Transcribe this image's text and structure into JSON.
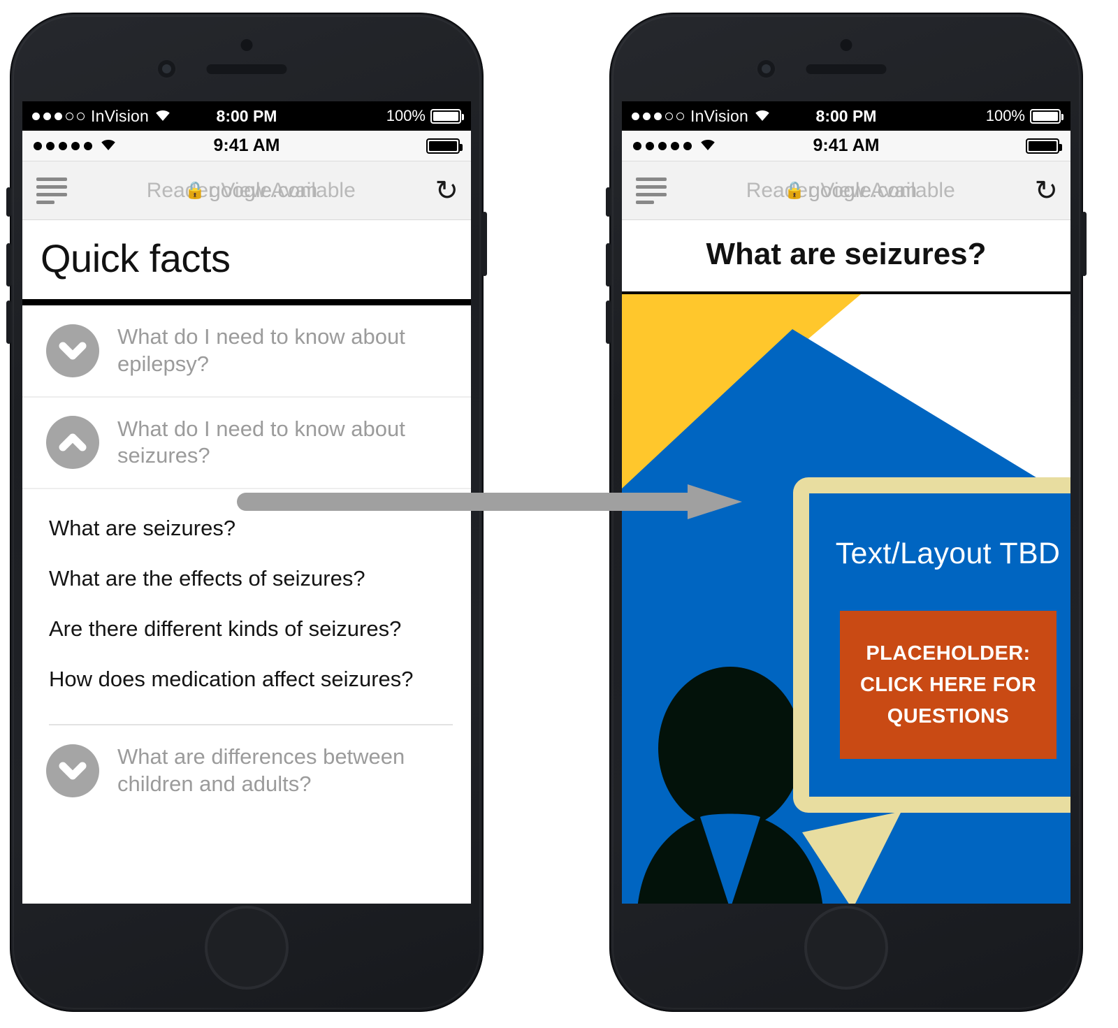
{
  "status_bar": {
    "invision": {
      "carrier": "InVision",
      "time": "8:00 PM",
      "battery_percent": "100%",
      "signal_filled": 3,
      "signal_total": 5,
      "wifi_icon": "wifi-icon",
      "battery_icon": "battery-full-icon"
    },
    "ios": {
      "time": "9:41 AM",
      "signal_dots": 5,
      "wifi_icon": "wifi-icon",
      "battery_icon": "battery-full-icon"
    }
  },
  "browser": {
    "reader_icon": "reader-view-icon",
    "reader_label": "Reader View Available",
    "lock_icon": "lock-icon",
    "site_label": "google.com",
    "reload_icon": "reload-icon",
    "reload_glyph": "↻"
  },
  "left_phone": {
    "page_title": "Quick facts",
    "accordion": [
      {
        "label": "What do I need to know about epilepsy?",
        "state": "collapsed",
        "icon": "chevron-down-icon"
      },
      {
        "label": "What do I need to know about seizures?",
        "state": "expanded",
        "icon": "chevron-up-icon"
      }
    ],
    "sub_items": [
      "What are seizures?",
      "What are the effects of seizures?",
      "Are there different kinds of seizures?",
      "How does medication affect seizures?"
    ],
    "accordion_tail": [
      {
        "label": "What are differences between children and adults?",
        "state": "collapsed",
        "icon": "chevron-down-icon"
      }
    ]
  },
  "right_phone": {
    "page_title": "What are seizures?",
    "illustration": {
      "bubble_text": "Text/Layout TBD",
      "cta_lines": [
        "PLACEHOLDER:",
        "CLICK HERE FOR",
        "QUESTIONS"
      ],
      "person_icon": "person-silhouette-icon",
      "bubble_icon": "speech-bubble-icon"
    }
  },
  "annotation": {
    "arrow_icon": "right-arrow-icon",
    "from": "What are seizures?",
    "to": "What are seizures?"
  },
  "colors": {
    "brand_blue": "#0065C1",
    "brand_yellow": "#FFC72C",
    "bubble_border_cream": "#E8DDA0",
    "cta_orange": "#C94A14",
    "silhouette_black": "#03120A",
    "arrow_gray": "#A0A0A0",
    "muted_text": "#9B9B9B",
    "body_text": "#141414",
    "phone_body": "#1F2126"
  }
}
